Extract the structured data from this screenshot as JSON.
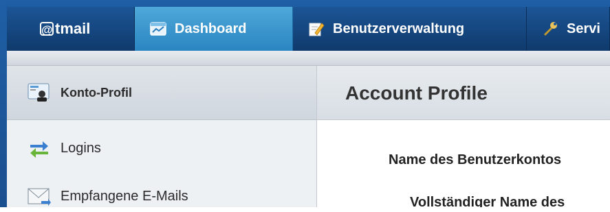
{
  "nav": {
    "logo_text": "tmail",
    "logo_at": "@",
    "tabs": [
      {
        "label": "Dashboard",
        "icon": "dashboard-icon",
        "active": true
      },
      {
        "label": "Benutzerverwaltung",
        "icon": "edit-pencil-icon",
        "active": false
      },
      {
        "label": "Servi",
        "icon": "wrench-icon",
        "active": false
      }
    ]
  },
  "sidebar": {
    "items": [
      {
        "label": "Konto-Profil",
        "icon": "profile-card-icon",
        "selected": true
      },
      {
        "label": "Logins",
        "icon": "arrows-swap-icon",
        "selected": false
      },
      {
        "label": "Empfangene E-Mails",
        "icon": "envelope-icon",
        "selected": false
      }
    ]
  },
  "main": {
    "title": "Account Profile",
    "fields": [
      {
        "label": "Name des Benutzerkontos"
      },
      {
        "label": "Vollständiger Name des"
      }
    ]
  },
  "colors": {
    "nav_bg": "#1a5597",
    "active_tab": "#3b96cf",
    "sidebar_bg": "#eef1f4"
  }
}
